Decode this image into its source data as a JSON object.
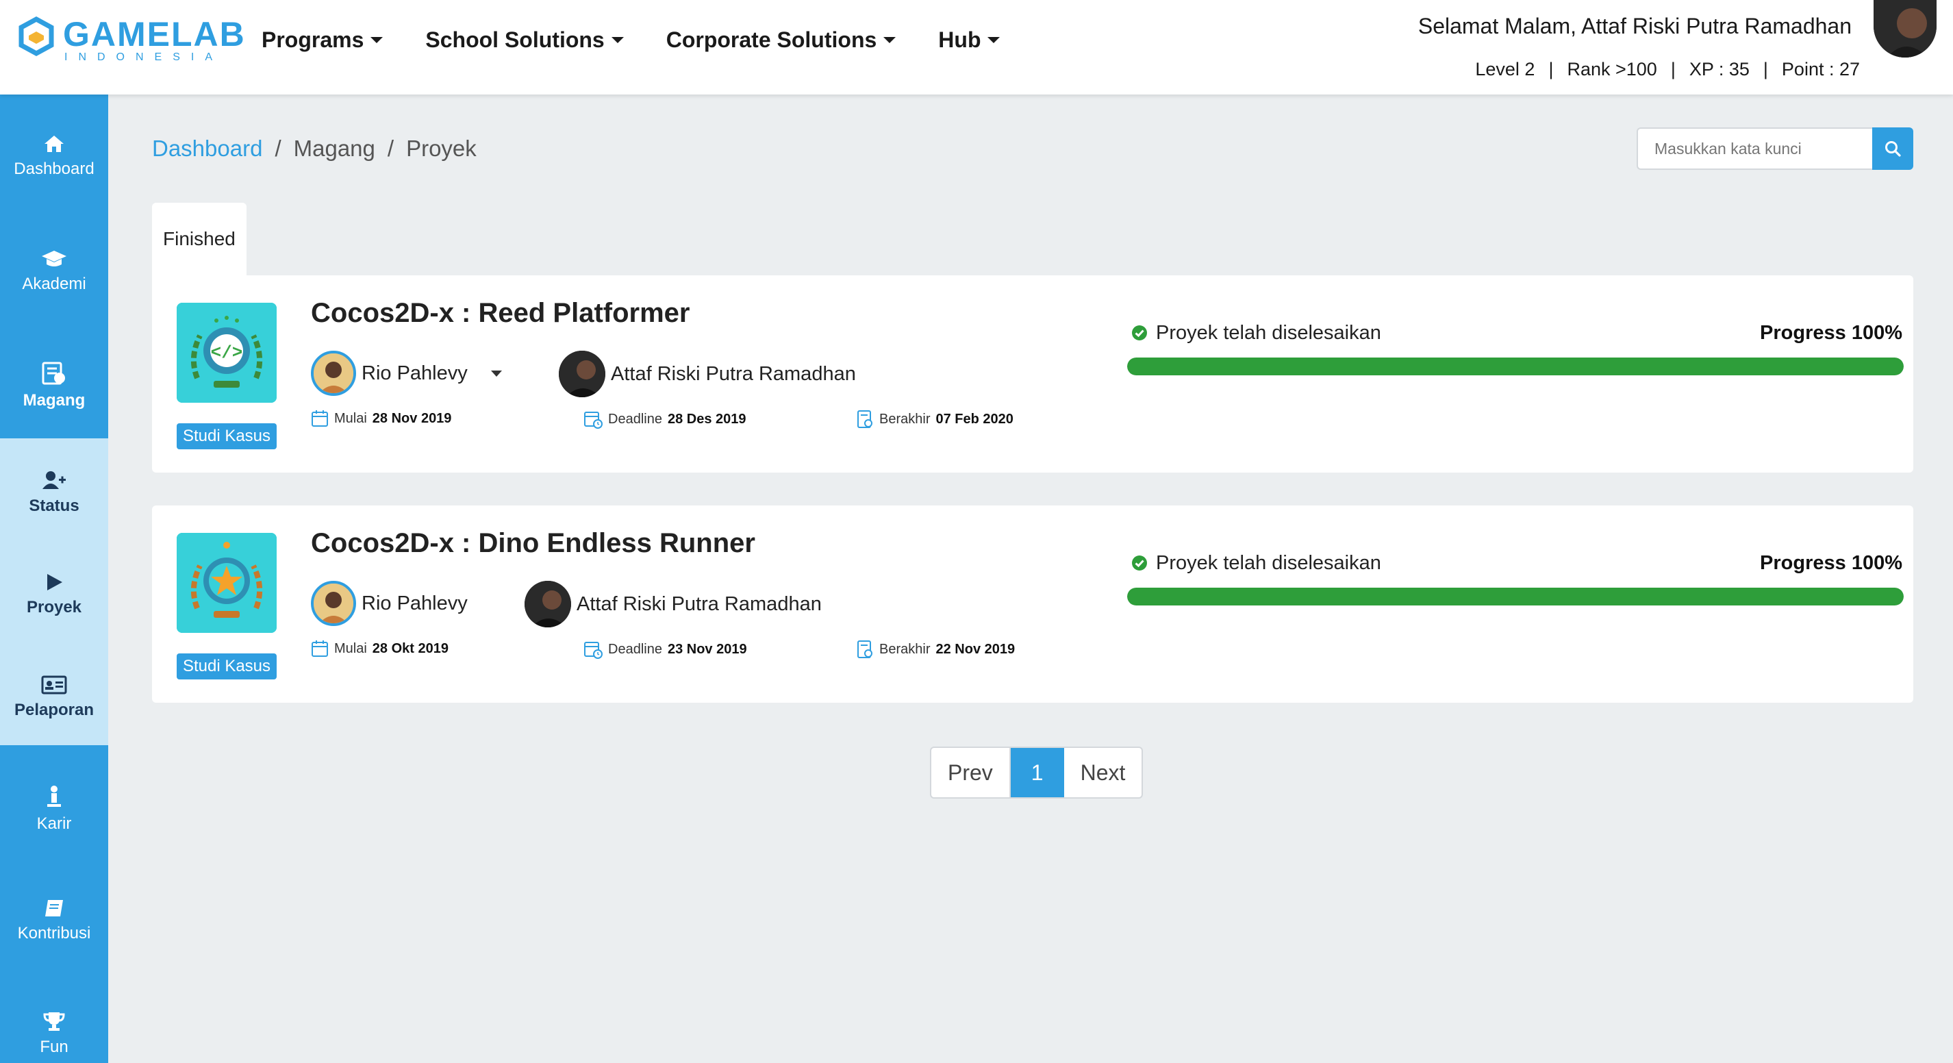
{
  "header": {
    "logo_text": "GAMELAB",
    "logo_sub": "INDONESIA",
    "nav": [
      {
        "label": "Programs"
      },
      {
        "label": "School Solutions"
      },
      {
        "label": "Corporate Solutions"
      },
      {
        "label": "Hub"
      }
    ],
    "greeting": "Selamat Malam, Attaf Riski Putra Ramadhan",
    "stats": {
      "level": "Level 2",
      "rank": "Rank >100",
      "xp": "XP : 35",
      "point": "Point : 27",
      "separator": "|"
    }
  },
  "sidebar": {
    "items": [
      {
        "label": "Dashboard",
        "icon": "home-icon"
      },
      {
        "label": "Akademi",
        "icon": "graduation-cap-icon"
      },
      {
        "label": "Magang",
        "icon": "internship-icon"
      },
      {
        "label": "Status",
        "icon": "user-plus-icon"
      },
      {
        "label": "Proyek",
        "icon": "play-icon"
      },
      {
        "label": "Pelaporan",
        "icon": "id-card-icon"
      },
      {
        "label": "Karir",
        "icon": "career-icon"
      },
      {
        "label": "Kontribusi",
        "icon": "book-icon"
      },
      {
        "label": "Fun",
        "icon": "trophy-icon"
      }
    ]
  },
  "breadcrumb": {
    "items": [
      "Dashboard",
      "Magang",
      "Proyek"
    ],
    "separator": "/"
  },
  "search": {
    "placeholder": "Masukkan kata kunci",
    "icon": "search-icon"
  },
  "tabs": [
    {
      "label": "Finished"
    }
  ],
  "projects": [
    {
      "title": "Cocos2D-x : Reed Platformer",
      "type": "Studi Kasus",
      "mentor": "Rio Pahlevy",
      "student": "Attaf Riski Putra Ramadhan",
      "start_label": "Mulai",
      "start": "28 Nov 2019",
      "deadline_label": "Deadline",
      "deadline": "28 Des 2019",
      "end_label": "Berakhir",
      "end": "07 Feb 2020",
      "status": "Proyek telah diselesaikan",
      "progress_label": "Progress 100%",
      "progress": 1.0
    },
    {
      "title": "Cocos2D-x : Dino Endless Runner",
      "type": "Studi Kasus",
      "mentor": "Rio Pahlevy",
      "student": "Attaf Riski Putra Ramadhan",
      "start_label": "Mulai",
      "start": "28 Okt 2019",
      "deadline_label": "Deadline",
      "deadline": "23 Nov 2019",
      "end_label": "Berakhir",
      "end": "22 Nov 2019",
      "status": "Proyek telah diselesaikan",
      "progress_label": "Progress 100%",
      "progress": 1.0
    }
  ],
  "pagination": {
    "prev": "Prev",
    "current": "1",
    "next": "Next"
  },
  "colors": {
    "accent": "#2f9ee0",
    "sidebar_active": "#c5e6f8",
    "progress": "#2e9e3a",
    "status_ok": "#2e9e3a"
  }
}
